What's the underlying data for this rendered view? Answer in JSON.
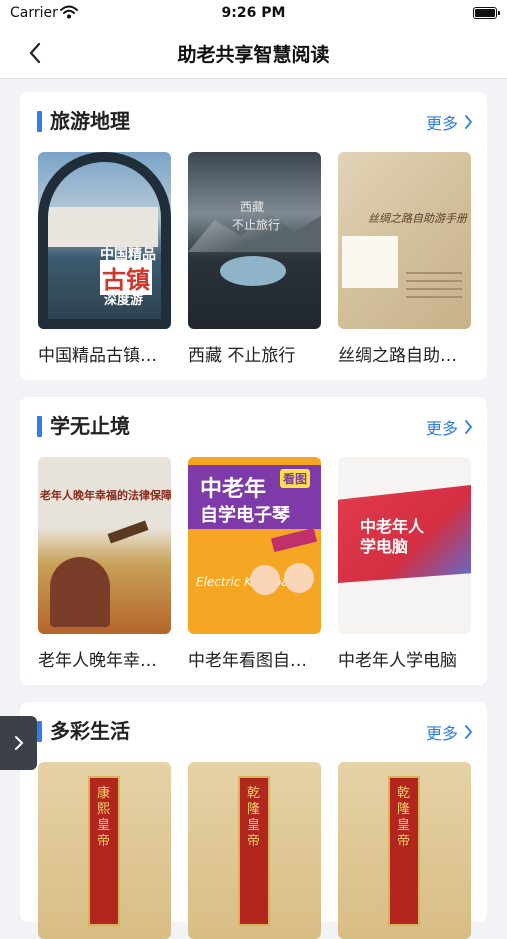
{
  "status_bar": {
    "carrier": "Carrier",
    "time": "9:26 PM"
  },
  "nav": {
    "title": "助老共享智慧阅读",
    "back_icon": "chevron-left-icon"
  },
  "sections": [
    {
      "title": "旅游地理",
      "more_label": "更多",
      "books": [
        {
          "title": "中国精品古镇深度游",
          "cover": {
            "line1": "中国精品",
            "line2": "古镇",
            "line3": "深度游"
          }
        },
        {
          "title": "西藏 不止旅行",
          "cover": {
            "line1": "西藏",
            "line2": "不止旅行"
          }
        },
        {
          "title": "丝绸之路自助游手册",
          "cover": {
            "line1": "丝绸之路自助游手册"
          }
        }
      ]
    },
    {
      "title": "学无止境",
      "more_label": "更多",
      "books": [
        {
          "title": "老年人晚年幸福的法律保障",
          "cover": {
            "line1": "老年人晚年幸福的法律保障"
          }
        },
        {
          "title": "中老年看图自学电子琴",
          "cover": {
            "line1": "中老年",
            "line2": "自学电子琴",
            "badge": "看图",
            "line3": "Electric Keyboard"
          }
        },
        {
          "title": "中老年人学电脑",
          "cover": {
            "line1": "中老年人",
            "line2": "学电脑"
          }
        }
      ]
    },
    {
      "title": "多彩生活",
      "more_label": "更多",
      "books": [
        {
          "title": "康熙皇帝",
          "cover": {
            "line1": "康熙皇帝"
          }
        },
        {
          "title": "乾隆皇帝",
          "cover": {
            "line1": "乾隆皇帝"
          }
        },
        {
          "title": "乾隆皇帝",
          "cover": {
            "line1": "乾隆皇帝"
          }
        }
      ]
    }
  ],
  "colors": {
    "accent": "#2f7de8",
    "background": "#f2f3f6"
  },
  "side_handle_icon": "chevron-right-icon"
}
